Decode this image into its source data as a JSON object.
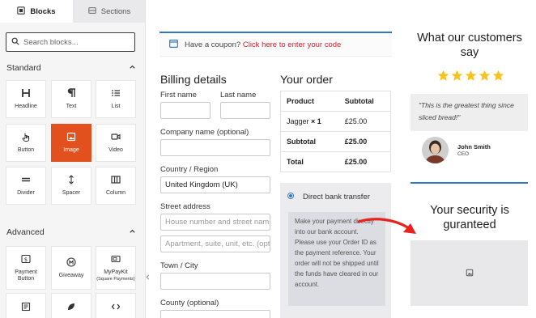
{
  "sidebar": {
    "tabs": [
      {
        "label": "Blocks",
        "icon": "blocks-icon",
        "active": true
      },
      {
        "label": "Sections",
        "icon": "sections-icon",
        "active": false
      }
    ],
    "search": {
      "placeholder": "Search blocks..."
    },
    "standard": {
      "title": "Standard",
      "blocks": [
        "Headline",
        "Text",
        "List",
        "Button",
        "Image",
        "Video",
        "Divider",
        "Spacer",
        "Column"
      ],
      "selected": "Image"
    },
    "advanced": {
      "title": "Advanced",
      "blocks": [
        "Payment Button",
        "Giveaway",
        "MyPayKit (Square Payments)"
      ],
      "block_sub": "(Square Payments)"
    }
  },
  "coupon": {
    "text": "Have a coupon?",
    "link": "Click here to enter your code"
  },
  "billing": {
    "title": "Billing details",
    "first_name": "First name",
    "last_name": "Last name",
    "company": "Company name (optional)",
    "country_label": "Country / Region",
    "country_value": "United Kingdom (UK)",
    "street_label": "Street address",
    "street_ph1": "House number and street name",
    "street_ph2": "Apartment, suite, unit, etc. (optional)",
    "town_label": "Town / City",
    "county_label": "County (optional)"
  },
  "order": {
    "title": "Your order",
    "col_product": "Product",
    "col_subtotal": "Subtotal",
    "item_name": "Jagger",
    "item_qty": "× 1",
    "item_price": "£25.00",
    "subtotal_label": "Subtotal",
    "subtotal_value": "£25.00",
    "total_label": "Total",
    "total_value": "£25.00",
    "payment_method": "Direct bank transfer",
    "payment_desc": "Make your payment directly into our bank account. Please use your Order ID as the payment reference. Your order will not be shipped until the funds have cleared in our account."
  },
  "testimonial": {
    "title": "What our customers say",
    "rating": 5,
    "quote": "\"This is the greatest thing since sliced bread!\"",
    "name": "John Smith",
    "role": "CEO"
  },
  "security": {
    "title": "Your security is guranteed"
  },
  "colors": {
    "accent": "#2f79c3",
    "selected_block": "#e2511d",
    "link_red": "#d31f2d",
    "star": "#f7c21b",
    "arrow": "#e8231f"
  }
}
